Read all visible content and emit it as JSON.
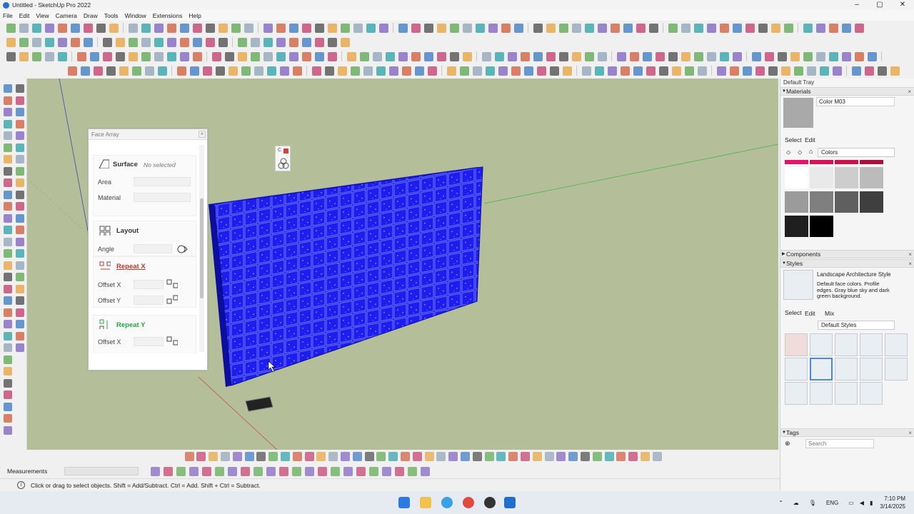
{
  "window": {
    "title": "Untitled - SketchUp Pro 2022",
    "controls": [
      "–",
      "▢",
      "✕"
    ]
  },
  "menu": [
    "File",
    "Edit",
    "View",
    "Camera",
    "Draw",
    "Tools",
    "Window",
    "Extensions",
    "Help"
  ],
  "face_array": {
    "title": "Face Array",
    "surface_label": "Surface",
    "surface_status": "No selected",
    "area_label": "Area",
    "material_label": "Material",
    "layout_label": "Layout",
    "angle_label": "Angle",
    "repeat_x_label": "Repeat X",
    "offset_x_label": "Offset X",
    "offset_y_label": "Offset Y",
    "repeat_y_label": "Repeat Y",
    "offset_x2_label": "Offset X",
    "close_glyph": "×"
  },
  "float_widget": {
    "label": "C"
  },
  "measurements": {
    "label": "Measurements"
  },
  "status": {
    "info_glyph": "i",
    "message": "Click or drag to select objects. Shift = Add/Subtract. Ctrl = Add. Shift + Ctrl = Subtract."
  },
  "tray": {
    "title": "Default Tray",
    "materials": {
      "header": "Materials",
      "current_name": "Color M03",
      "current_color": "#a9a9a9",
      "tab_select": "Select",
      "tab_edit": "Edit",
      "library": "Colors",
      "swatches": [
        "#e3156b",
        "#d4145a",
        "#c8124e",
        "#a8113f",
        "#ffffff",
        "#e9e9e9",
        "#cdcdcd",
        "#bbbbbb",
        "#9b9b9b",
        "#7f7f7f",
        "#5f5f5f",
        "#3f3f3f",
        "#1f1f1f",
        "#000000"
      ]
    },
    "components": {
      "header": "Components"
    },
    "styles": {
      "header": "Styles",
      "name": "Landscape Architecture Style",
      "description": "Default face colors. Profile edges. Gray blue sky and dark green background.",
      "tab_select": "Select",
      "tab_edit": "Edit",
      "tab_mix": "Mix",
      "library": "Default Styles"
    },
    "tags": {
      "header": "Tags",
      "search_placeholder": "Search"
    }
  },
  "taskbar": {
    "language": "ENG",
    "time": "7:10 PM",
    "date": "3/14/2025"
  }
}
